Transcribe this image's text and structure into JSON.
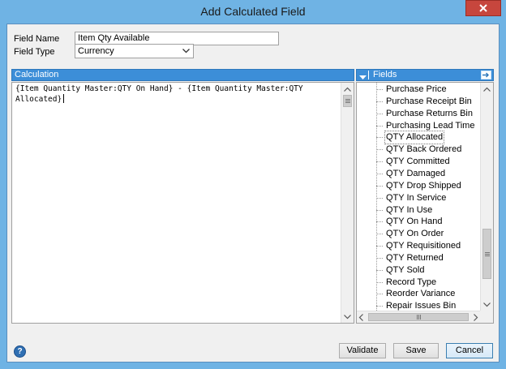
{
  "window": {
    "title": "Add Calculated Field"
  },
  "form": {
    "field_name_label": "Field Name",
    "field_name_value": "Item Qty Available",
    "field_type_label": "Field Type",
    "field_type_value": "Currency"
  },
  "calculation": {
    "header": "Calculation",
    "line1": "{Item Quantity Master:QTY On Hand} - {Item Quantity Master:QTY",
    "line2": "Allocated}"
  },
  "fields": {
    "header": "Fields",
    "items": [
      "Purchase Price",
      "Purchase Receipt Bin",
      "Purchase Returns Bin",
      "Purchasing Lead Time",
      "QTY Allocated",
      "QTY Back Ordered",
      "QTY Committed",
      "QTY Damaged",
      "QTY Drop Shipped",
      "QTY In Service",
      "QTY In Use",
      "QTY On Hand",
      "QTY On Order",
      "QTY Requisitioned",
      "QTY Returned",
      "QTY Sold",
      "Record Type",
      "Reorder Variance",
      "Repair Issues Bin"
    ],
    "selected": "QTY Allocated"
  },
  "buttons": {
    "validate": "Validate",
    "save": "Save",
    "cancel": "Cancel",
    "help": "?"
  }
}
